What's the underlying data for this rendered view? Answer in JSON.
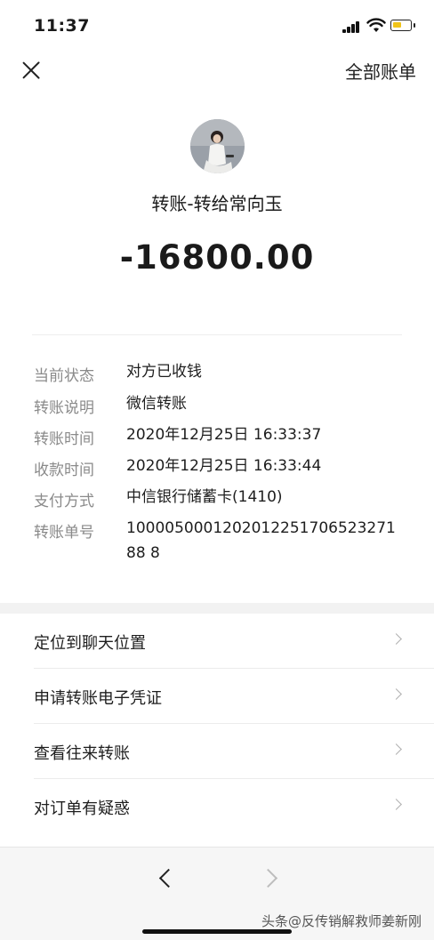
{
  "status_bar": {
    "time": "11:37"
  },
  "nav": {
    "right_label": "全部账单"
  },
  "header": {
    "title": "转账-转给常向玉",
    "amount": "-16800.00"
  },
  "details": [
    {
      "label": "当前状态",
      "value": "对方已收钱"
    },
    {
      "label": "转账说明",
      "value": "微信转账"
    },
    {
      "label": "转账时间",
      "value": "2020年12月25日 16:33:37"
    },
    {
      "label": "收款时间",
      "value": "2020年12月25日 16:33:44"
    },
    {
      "label": "支付方式",
      "value": "中信银行储蓄卡(1410)"
    },
    {
      "label": "转账单号",
      "value": "100005000120201225170652327188 8"
    }
  ],
  "menu": [
    {
      "label": "定位到聊天位置"
    },
    {
      "label": "申请转账电子凭证"
    },
    {
      "label": "查看往来转账"
    },
    {
      "label": "对订单有疑惑"
    }
  ],
  "watermark": {
    "text": "头条@反传销解救师姜新刚"
  },
  "colors": {
    "label_gray": "#8a8a8a",
    "background": "#ffffff",
    "section_gap": "#f2f2f2"
  }
}
